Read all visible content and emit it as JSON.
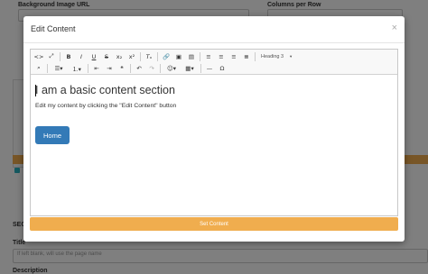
{
  "background": {
    "bg_image_label": "Background Image URL",
    "columns_label": "Columns per Row",
    "seo_label": "SEO",
    "title_label": "Title",
    "title_placeholder": "If left blank, will use the page name",
    "description_label": "Description",
    "orange_color": "#f0ad4e",
    "accent_color": "#2bb3c0"
  },
  "modal": {
    "title": "Edit Content",
    "close": "×"
  },
  "toolbar": {
    "heading_select": "Heading 3"
  },
  "content": {
    "heading": "I am a basic content section",
    "paragraph": "Edit my content by clicking the \"Edit Content\" button",
    "home_button": "Home"
  },
  "footer": {
    "set_content": "Set Content"
  },
  "colors": {
    "primary": "#337ab7",
    "warning": "#f0ad4e",
    "overlay": "rgba(0,0,0,0.5)"
  }
}
